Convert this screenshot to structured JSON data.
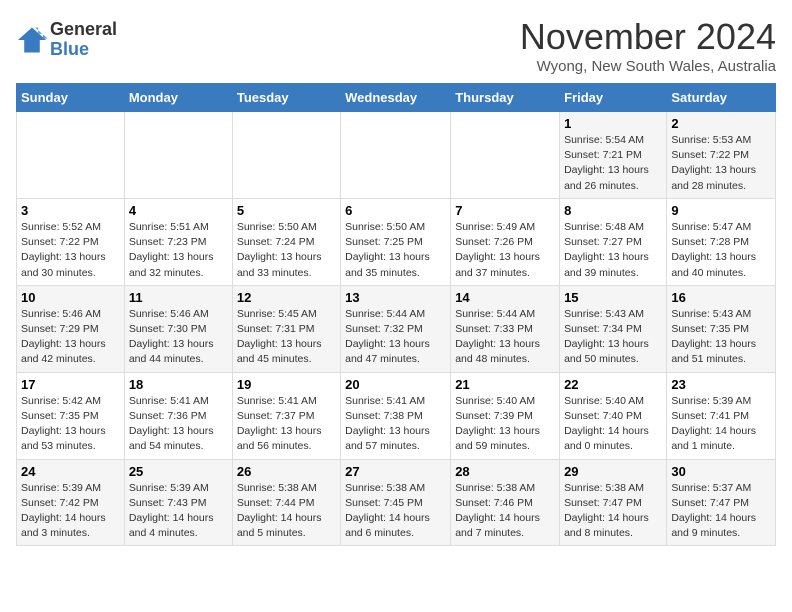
{
  "logo": {
    "general": "General",
    "blue": "Blue"
  },
  "title": "November 2024",
  "location": "Wyong, New South Wales, Australia",
  "weekdays": [
    "Sunday",
    "Monday",
    "Tuesday",
    "Wednesday",
    "Thursday",
    "Friday",
    "Saturday"
  ],
  "weeks": [
    [
      {
        "day": "",
        "info": ""
      },
      {
        "day": "",
        "info": ""
      },
      {
        "day": "",
        "info": ""
      },
      {
        "day": "",
        "info": ""
      },
      {
        "day": "",
        "info": ""
      },
      {
        "day": "1",
        "info": "Sunrise: 5:54 AM\nSunset: 7:21 PM\nDaylight: 13 hours\nand 26 minutes."
      },
      {
        "day": "2",
        "info": "Sunrise: 5:53 AM\nSunset: 7:22 PM\nDaylight: 13 hours\nand 28 minutes."
      }
    ],
    [
      {
        "day": "3",
        "info": "Sunrise: 5:52 AM\nSunset: 7:22 PM\nDaylight: 13 hours\nand 30 minutes."
      },
      {
        "day": "4",
        "info": "Sunrise: 5:51 AM\nSunset: 7:23 PM\nDaylight: 13 hours\nand 32 minutes."
      },
      {
        "day": "5",
        "info": "Sunrise: 5:50 AM\nSunset: 7:24 PM\nDaylight: 13 hours\nand 33 minutes."
      },
      {
        "day": "6",
        "info": "Sunrise: 5:50 AM\nSunset: 7:25 PM\nDaylight: 13 hours\nand 35 minutes."
      },
      {
        "day": "7",
        "info": "Sunrise: 5:49 AM\nSunset: 7:26 PM\nDaylight: 13 hours\nand 37 minutes."
      },
      {
        "day": "8",
        "info": "Sunrise: 5:48 AM\nSunset: 7:27 PM\nDaylight: 13 hours\nand 39 minutes."
      },
      {
        "day": "9",
        "info": "Sunrise: 5:47 AM\nSunset: 7:28 PM\nDaylight: 13 hours\nand 40 minutes."
      }
    ],
    [
      {
        "day": "10",
        "info": "Sunrise: 5:46 AM\nSunset: 7:29 PM\nDaylight: 13 hours\nand 42 minutes."
      },
      {
        "day": "11",
        "info": "Sunrise: 5:46 AM\nSunset: 7:30 PM\nDaylight: 13 hours\nand 44 minutes."
      },
      {
        "day": "12",
        "info": "Sunrise: 5:45 AM\nSunset: 7:31 PM\nDaylight: 13 hours\nand 45 minutes."
      },
      {
        "day": "13",
        "info": "Sunrise: 5:44 AM\nSunset: 7:32 PM\nDaylight: 13 hours\nand 47 minutes."
      },
      {
        "day": "14",
        "info": "Sunrise: 5:44 AM\nSunset: 7:33 PM\nDaylight: 13 hours\nand 48 minutes."
      },
      {
        "day": "15",
        "info": "Sunrise: 5:43 AM\nSunset: 7:34 PM\nDaylight: 13 hours\nand 50 minutes."
      },
      {
        "day": "16",
        "info": "Sunrise: 5:43 AM\nSunset: 7:35 PM\nDaylight: 13 hours\nand 51 minutes."
      }
    ],
    [
      {
        "day": "17",
        "info": "Sunrise: 5:42 AM\nSunset: 7:35 PM\nDaylight: 13 hours\nand 53 minutes."
      },
      {
        "day": "18",
        "info": "Sunrise: 5:41 AM\nSunset: 7:36 PM\nDaylight: 13 hours\nand 54 minutes."
      },
      {
        "day": "19",
        "info": "Sunrise: 5:41 AM\nSunset: 7:37 PM\nDaylight: 13 hours\nand 56 minutes."
      },
      {
        "day": "20",
        "info": "Sunrise: 5:41 AM\nSunset: 7:38 PM\nDaylight: 13 hours\nand 57 minutes."
      },
      {
        "day": "21",
        "info": "Sunrise: 5:40 AM\nSunset: 7:39 PM\nDaylight: 13 hours\nand 59 minutes."
      },
      {
        "day": "22",
        "info": "Sunrise: 5:40 AM\nSunset: 7:40 PM\nDaylight: 14 hours\nand 0 minutes."
      },
      {
        "day": "23",
        "info": "Sunrise: 5:39 AM\nSunset: 7:41 PM\nDaylight: 14 hours\nand 1 minute."
      }
    ],
    [
      {
        "day": "24",
        "info": "Sunrise: 5:39 AM\nSunset: 7:42 PM\nDaylight: 14 hours\nand 3 minutes."
      },
      {
        "day": "25",
        "info": "Sunrise: 5:39 AM\nSunset: 7:43 PM\nDaylight: 14 hours\nand 4 minutes."
      },
      {
        "day": "26",
        "info": "Sunrise: 5:38 AM\nSunset: 7:44 PM\nDaylight: 14 hours\nand 5 minutes."
      },
      {
        "day": "27",
        "info": "Sunrise: 5:38 AM\nSunset: 7:45 PM\nDaylight: 14 hours\nand 6 minutes."
      },
      {
        "day": "28",
        "info": "Sunrise: 5:38 AM\nSunset: 7:46 PM\nDaylight: 14 hours\nand 7 minutes."
      },
      {
        "day": "29",
        "info": "Sunrise: 5:38 AM\nSunset: 7:47 PM\nDaylight: 14 hours\nand 8 minutes."
      },
      {
        "day": "30",
        "info": "Sunrise: 5:37 AM\nSunset: 7:47 PM\nDaylight: 14 hours\nand 9 minutes."
      }
    ]
  ]
}
